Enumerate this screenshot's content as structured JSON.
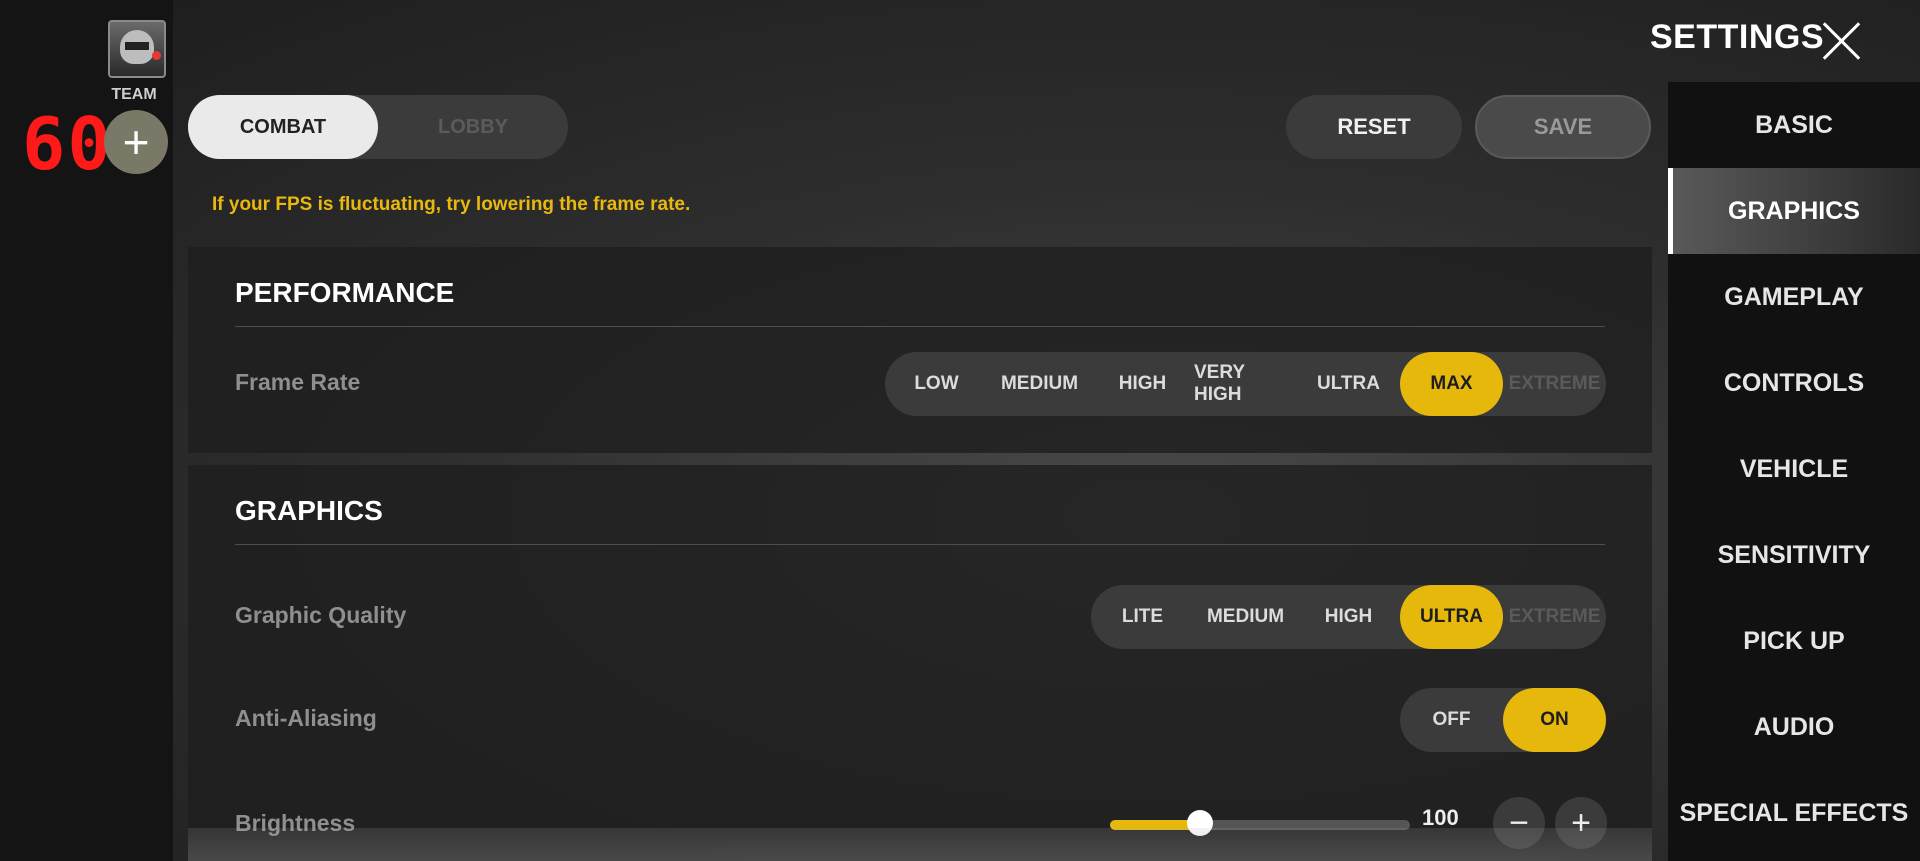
{
  "left_rail": {
    "team_label": "TEAM",
    "fps": "60",
    "add_icon": "plus-icon"
  },
  "header": {
    "title": "SETTINGS",
    "close_icon": "close-icon"
  },
  "mode_toggle": {
    "combat": "COMBAT",
    "lobby": "LOBBY",
    "selected": "COMBAT"
  },
  "actions": {
    "reset": "RESET",
    "save": "SAVE"
  },
  "hint": "If your FPS is fluctuating, try lowering the frame rate.",
  "sidebar": {
    "items": [
      {
        "label": "BASIC"
      },
      {
        "label": "GRAPHICS"
      },
      {
        "label": "GAMEPLAY"
      },
      {
        "label": "CONTROLS"
      },
      {
        "label": "VEHICLE"
      },
      {
        "label": "SENSITIVITY"
      },
      {
        "label": "PICK UP"
      },
      {
        "label": "AUDIO"
      },
      {
        "label": "SPECIAL EFFECTS"
      }
    ],
    "active": "GRAPHICS"
  },
  "performance": {
    "title": "PERFORMANCE",
    "frame_rate": {
      "label": "Frame Rate",
      "options": [
        "LOW",
        "MEDIUM",
        "HIGH",
        "VERY HIGH",
        "ULTRA",
        "MAX",
        "EXTREME"
      ],
      "selected": "MAX",
      "disabled": [
        "EXTREME"
      ]
    }
  },
  "graphics": {
    "title": "GRAPHICS",
    "graphic_quality": {
      "label": "Graphic Quality",
      "options": [
        "LITE",
        "MEDIUM",
        "HIGH",
        "ULTRA",
        "EXTREME"
      ],
      "selected": "ULTRA",
      "disabled": [
        "EXTREME"
      ]
    },
    "anti_aliasing": {
      "label": "Anti-Aliasing",
      "options": [
        "OFF",
        "ON"
      ],
      "selected": "ON"
    },
    "brightness": {
      "label": "Brightness",
      "value": "100",
      "fill_fraction": 0.3,
      "minus_icon": "minus-icon",
      "plus_icon": "plus-icon"
    }
  },
  "colors": {
    "accent": "#e6b80c",
    "hint": "#e8b80e",
    "fps": "#ff1a1a"
  }
}
